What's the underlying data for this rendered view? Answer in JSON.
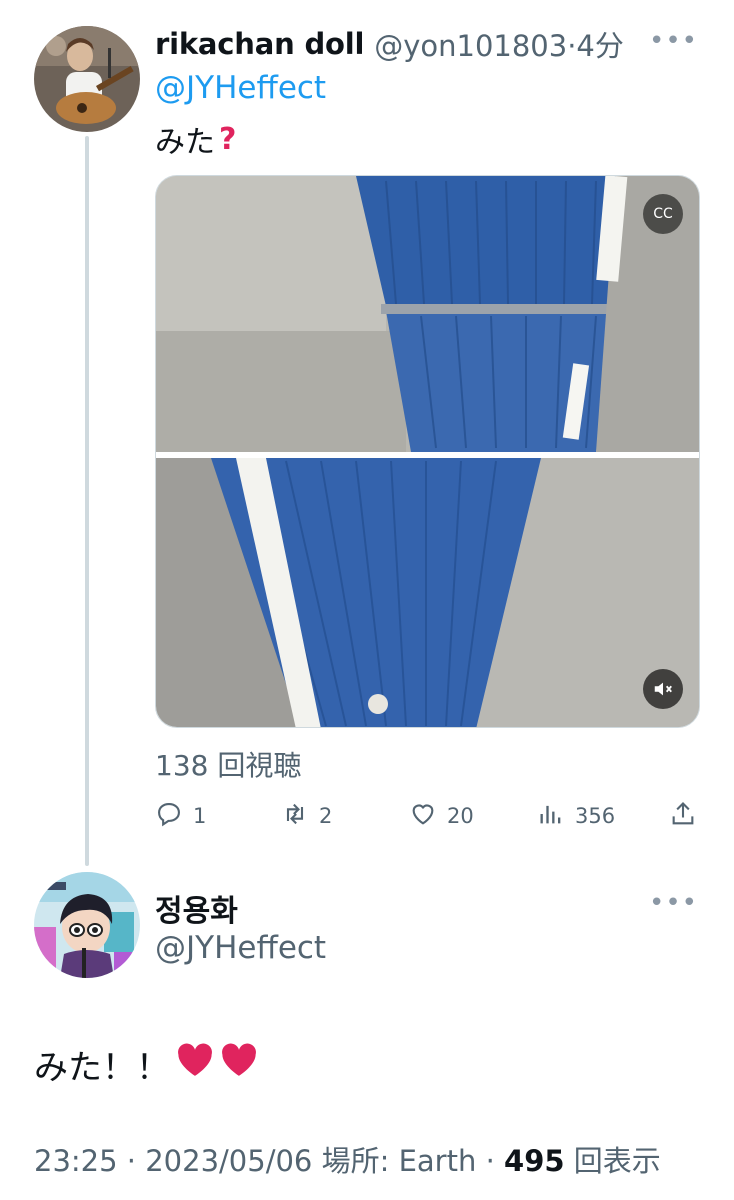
{
  "reply_tweet": {
    "name": "rikachan doll",
    "handle_time": "@yon101803·4分",
    "mention": "@JYHeffect",
    "text": "みた",
    "emoji_icon": "red-question-mark-icon",
    "views_label": "138 回視聴",
    "actions": {
      "reply_count": "1",
      "retweet_count": "2",
      "like_count": "20",
      "view_count": "356"
    }
  },
  "main_tweet": {
    "name": "정용화",
    "handle": "@JYHeffect",
    "text": "みた！！",
    "emoji_icons": [
      "red-heart-icon",
      "red-heart-icon"
    ],
    "meta_prefix": "23:25 · 2023/05/06 場所: Earth · ",
    "view_count": "495",
    "view_suffix": " 回表示"
  },
  "colors": {
    "link_blue": "#1d9bf0",
    "secondary_text": "#536471",
    "thread_line": "#cfd9de",
    "heart_red": "#e0245e"
  }
}
